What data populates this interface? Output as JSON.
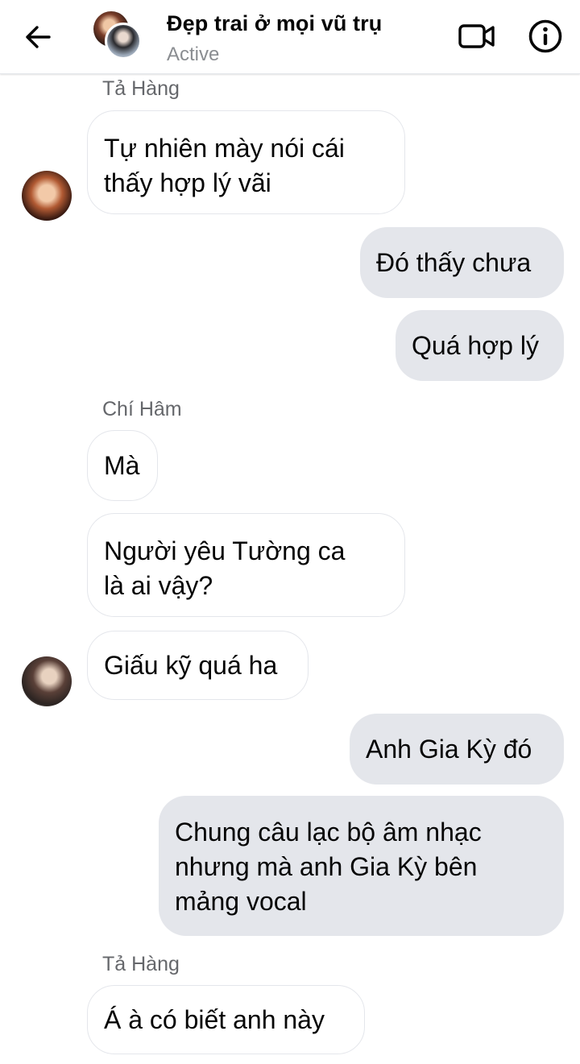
{
  "header": {
    "title": "Đẹp trai ở mọi vũ trụ",
    "status": "Active"
  },
  "messages": [
    {
      "sender": "Tả Hàng",
      "text_lines": [
        "Tự nhiên mày nói cái",
        "thấy hợp lý vãi"
      ]
    },
    {
      "text": "Đó thấy chưa"
    },
    {
      "text": "Quá hợp lý"
    },
    {
      "sender": "Chí Hâm",
      "text": "Mà"
    },
    {
      "text_lines": [
        "Người yêu Tường ca",
        "là ai vậy?"
      ]
    },
    {
      "text": "Giấu kỹ quá ha"
    },
    {
      "text": "Anh Gia Kỳ đó"
    },
    {
      "text_lines": [
        "Chung câu lạc bộ âm nhạc",
        "nhưng mà anh Gia Kỳ bên",
        "mảng vocal"
      ]
    },
    {
      "sender": "Tả Hàng",
      "text": "Á à có biết anh này"
    }
  ],
  "colors": {
    "outgoing_bubble": "#e4e6eb",
    "incoming_bubble": "#ffffff",
    "secondary_text": "#65676b"
  },
  "icons": {
    "back": "arrow-left-icon",
    "video": "video-camera-icon",
    "info": "info-icon"
  }
}
